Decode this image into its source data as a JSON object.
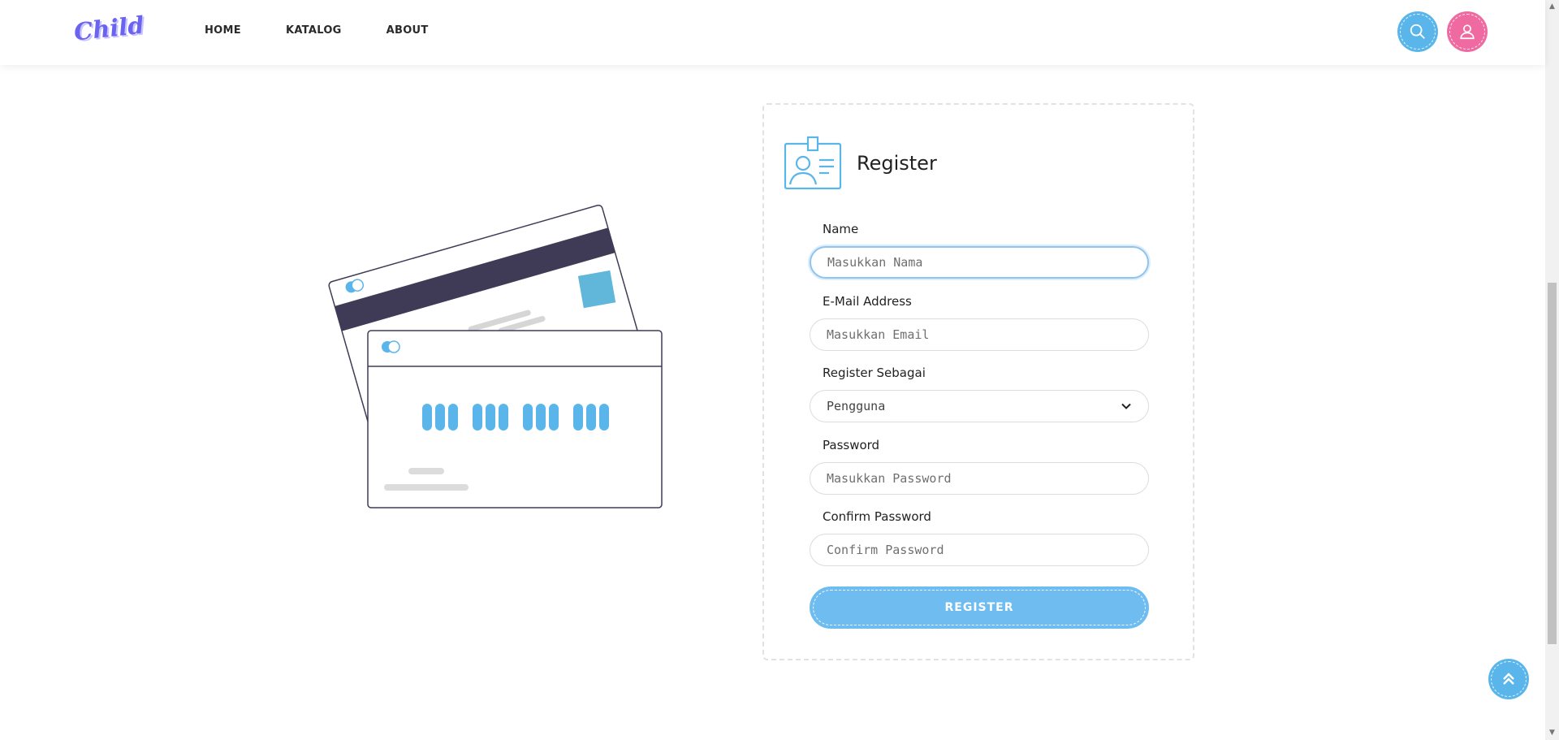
{
  "header": {
    "logo_text": "Child",
    "nav": [
      {
        "label": "HOME"
      },
      {
        "label": "KATALOG"
      },
      {
        "label": "ABOUT"
      }
    ],
    "search_icon": "search-icon",
    "user_icon": "user-icon"
  },
  "register": {
    "title": "Register",
    "name_label": "Name",
    "name_placeholder": "Masukkan Nama",
    "email_label": "E-Mail Address",
    "email_placeholder": "Masukkan Email",
    "role_label": "Register Sebagai",
    "role_value": "Pengguna",
    "password_label": "Password",
    "password_placeholder": "Masukkan Password",
    "confirm_label": "Confirm Password",
    "confirm_placeholder": "Confirm Password",
    "submit_label": "REGISTER"
  },
  "colors": {
    "accent_blue": "#6fbdf0",
    "accent_pink": "#ef6aa1",
    "logo": "#6a63f0",
    "dark_stripe": "#3f3b56"
  }
}
